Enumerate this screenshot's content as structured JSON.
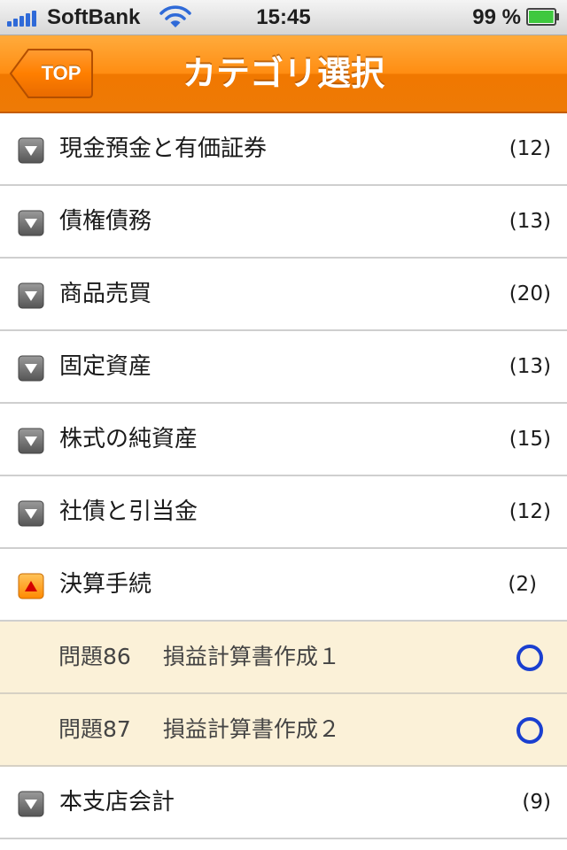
{
  "status_bar": {
    "carrier": "SoftBank",
    "time": "15:45",
    "battery_percent": "99 %",
    "battery_level": 0.99
  },
  "nav": {
    "back_label": "TOP",
    "title": "カテゴリ選択"
  },
  "colors": {
    "nav_orange": "#ff8d12",
    "sub_row_bg": "#fbf1d8",
    "circle_blue": "#1a3fd0",
    "expand_icon_gray": "#6e6e6e",
    "collapse_icon_orange": "#ff9a1a"
  },
  "categories": [
    {
      "label": "現金預金と有価証券",
      "count": "(12)",
      "icon": "triangle-down-icon"
    },
    {
      "label": "債権債務",
      "count": "(13)",
      "icon": "triangle-down-icon"
    },
    {
      "label": "商品売買",
      "count": "(20)",
      "icon": "triangle-down-icon"
    },
    {
      "label": "固定資産",
      "count": "(13)",
      "icon": "triangle-down-icon"
    },
    {
      "label": "株式の純資産",
      "count": "(15)",
      "icon": "triangle-down-icon"
    },
    {
      "label": "社債と引当金",
      "count": "(12)",
      "icon": "triangle-down-icon"
    },
    {
      "label": "決算手続",
      "count": "(2)",
      "icon": "triangle-up-icon"
    }
  ],
  "sub_items": [
    {
      "number": "問題86",
      "title": "損益計算書作成１",
      "status": "circle-icon"
    },
    {
      "number": "問題87",
      "title": "損益計算書作成２",
      "status": "circle-icon"
    }
  ],
  "after_categories": [
    {
      "label": "本支店会計",
      "count": "(9)",
      "icon": "triangle-down-icon"
    }
  ]
}
